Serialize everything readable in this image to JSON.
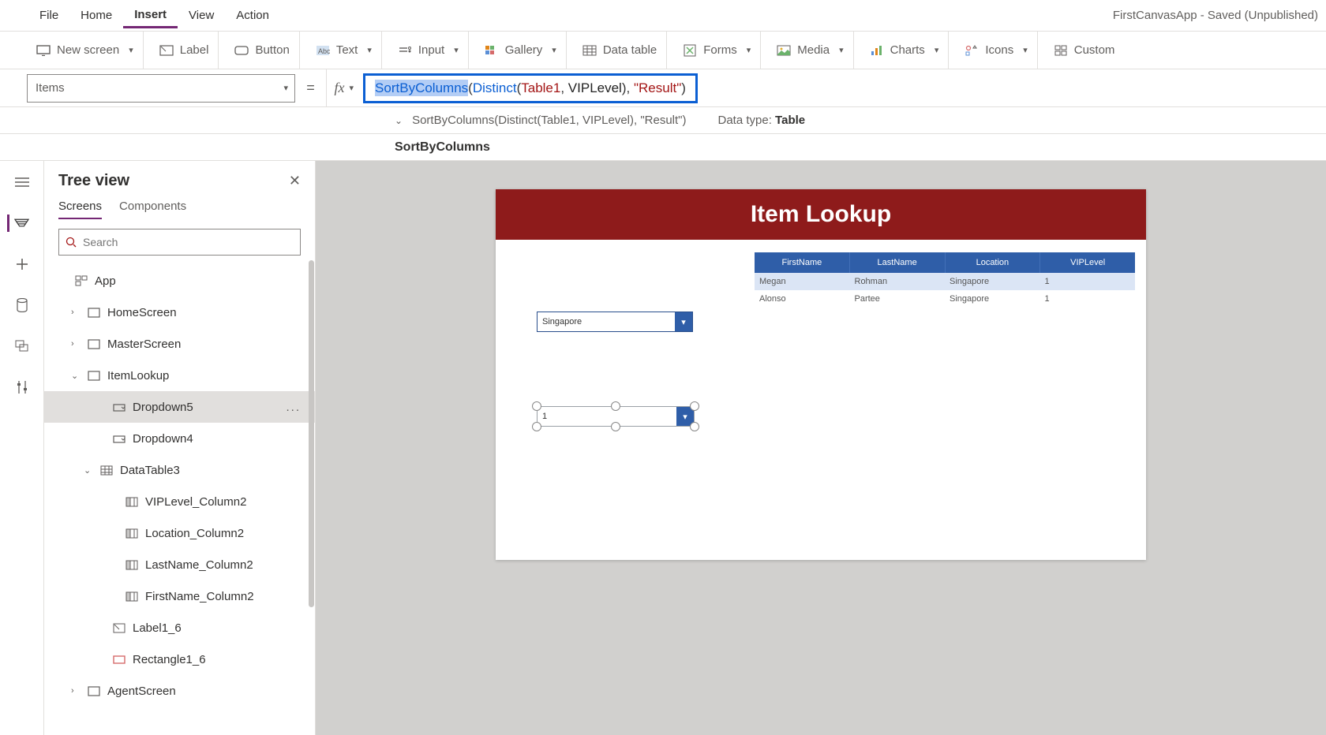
{
  "menubar": {
    "items": [
      "File",
      "Home",
      "Insert",
      "View",
      "Action"
    ],
    "active": "Insert"
  },
  "app_title": "FirstCanvasApp - Saved (Unpublished)",
  "ribbon": {
    "new_screen": "New screen",
    "label": "Label",
    "button": "Button",
    "text": "Text",
    "input": "Input",
    "gallery": "Gallery",
    "data_table": "Data table",
    "forms": "Forms",
    "media": "Media",
    "charts": "Charts",
    "icons": "Icons",
    "custom": "Custom"
  },
  "property": {
    "name": "Items",
    "equals": "="
  },
  "formula": {
    "fn1": "SortByColumns",
    "fn2": "Distinct",
    "table": "Table1",
    "col": "VIPLevel",
    "str": "\"Result\"",
    "paren_open": "(",
    "paren_close": ")",
    "comma": ", ",
    "comma2": ", "
  },
  "suggest": {
    "text": "SortByColumns(Distinct(Table1, VIPLevel), \"Result\")",
    "datatype_label": "Data type: ",
    "datatype_value": "Table"
  },
  "func_name": "SortByColumns",
  "tree": {
    "title": "Tree view",
    "tabs": [
      "Screens",
      "Components"
    ],
    "active_tab": "Screens",
    "search_placeholder": "Search",
    "app": "App",
    "items": [
      {
        "label": "HomeScreen",
        "icon": "screen",
        "chev": "›",
        "indent": 1
      },
      {
        "label": "MasterScreen",
        "icon": "screen",
        "chev": "›",
        "indent": 1
      },
      {
        "label": "ItemLookup",
        "icon": "screen",
        "chev": "⌄",
        "indent": 1
      },
      {
        "label": "Dropdown5",
        "icon": "dropdown",
        "indent": 3,
        "selected": true,
        "more": "..."
      },
      {
        "label": "Dropdown4",
        "icon": "dropdown",
        "indent": 3
      },
      {
        "label": "DataTable3",
        "icon": "table",
        "chev": "⌄",
        "indent": 2
      },
      {
        "label": "VIPLevel_Column2",
        "icon": "column",
        "indent": 4
      },
      {
        "label": "Location_Column2",
        "icon": "column",
        "indent": 4
      },
      {
        "label": "LastName_Column2",
        "icon": "column",
        "indent": 4
      },
      {
        "label": "FirstName_Column2",
        "icon": "column",
        "indent": 4
      },
      {
        "label": "Label1_6",
        "icon": "label",
        "indent": 3
      },
      {
        "label": "Rectangle1_6",
        "icon": "rect",
        "indent": 3
      },
      {
        "label": "AgentScreen",
        "icon": "screen",
        "chev": "›",
        "indent": 1
      }
    ]
  },
  "screen": {
    "title": "Item Lookup",
    "dropdown1": "Singapore",
    "dropdown2": "1",
    "table": {
      "headers": [
        "FirstName",
        "LastName",
        "Location",
        "VIPLevel"
      ],
      "rows": [
        [
          "Megan",
          "Rohman",
          "Singapore",
          "1"
        ],
        [
          "Alonso",
          "Partee",
          "Singapore",
          "1"
        ]
      ]
    }
  }
}
